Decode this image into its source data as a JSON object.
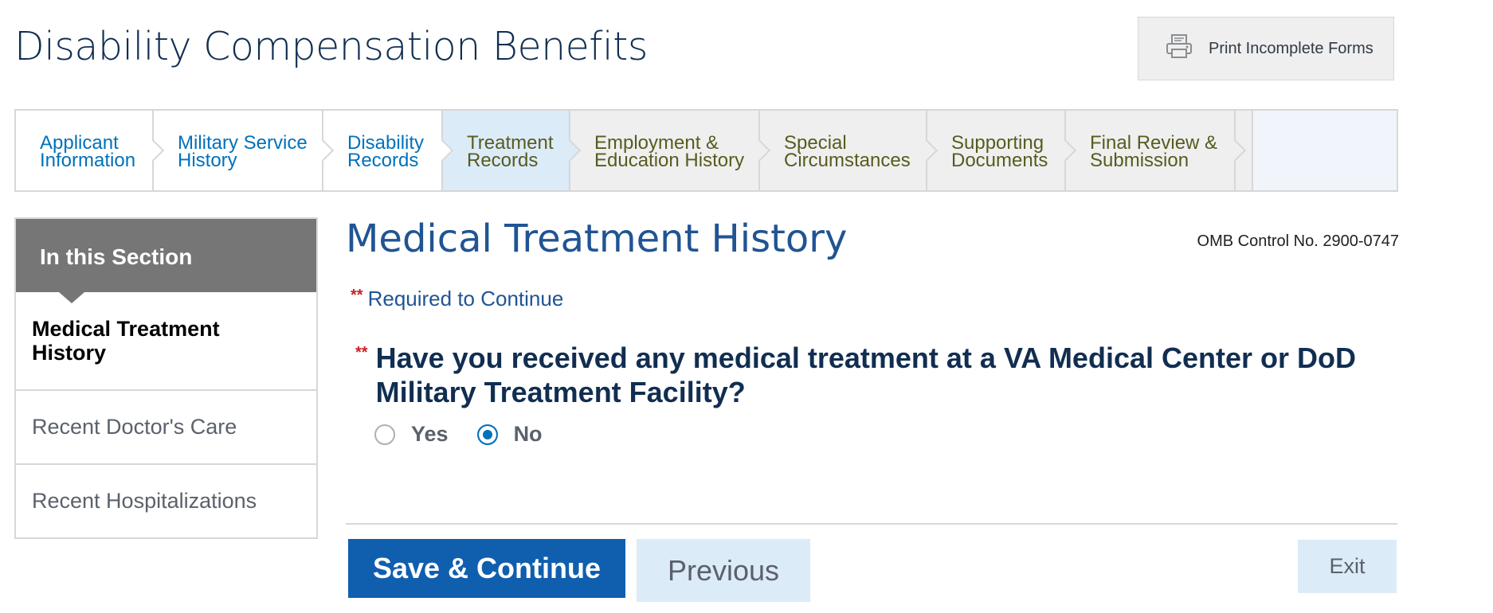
{
  "header": {
    "title": "Disability Compensation Benefits",
    "print_button": {
      "label": "Print Incomplete Forms",
      "icon": "printer-icon"
    }
  },
  "steps": [
    {
      "label": "Applicant\nInformation",
      "state": "done"
    },
    {
      "label": "Military Service\nHistory",
      "state": "done"
    },
    {
      "label": "Disability\nRecords",
      "state": "done"
    },
    {
      "label": "Treatment\nRecords",
      "state": "current"
    },
    {
      "label": "Employment &\nEducation History",
      "state": "todo"
    },
    {
      "label": "Special\nCircumstances",
      "state": "todo"
    },
    {
      "label": "Supporting\nDocuments",
      "state": "todo"
    },
    {
      "label": "Final Review &\nSubmission",
      "state": "todo"
    }
  ],
  "sidebar": {
    "heading": "In this Section",
    "items": [
      {
        "label": "Medical Treatment History",
        "active": true
      },
      {
        "label": "Recent Doctor's Care",
        "active": false
      },
      {
        "label": "Recent Hospitalizations",
        "active": false
      }
    ]
  },
  "main": {
    "title": "Medical Treatment History",
    "omb": "OMB Control No. 2900-0747",
    "required_marker": "**",
    "required_note": "Required to Continue",
    "question": "Have you received any medical treatment at a VA Medical Center or DoD Military Treatment Facility?",
    "options": [
      {
        "label": "Yes",
        "selected": false
      },
      {
        "label": "No",
        "selected": true
      }
    ]
  },
  "actions": {
    "save_continue": "Save & Continue",
    "previous": "Previous",
    "exit": "Exit"
  },
  "colors": {
    "title": "#112e51",
    "link": "#0071bb",
    "primary_button": "#0f5fae",
    "required": "#cd2026"
  }
}
